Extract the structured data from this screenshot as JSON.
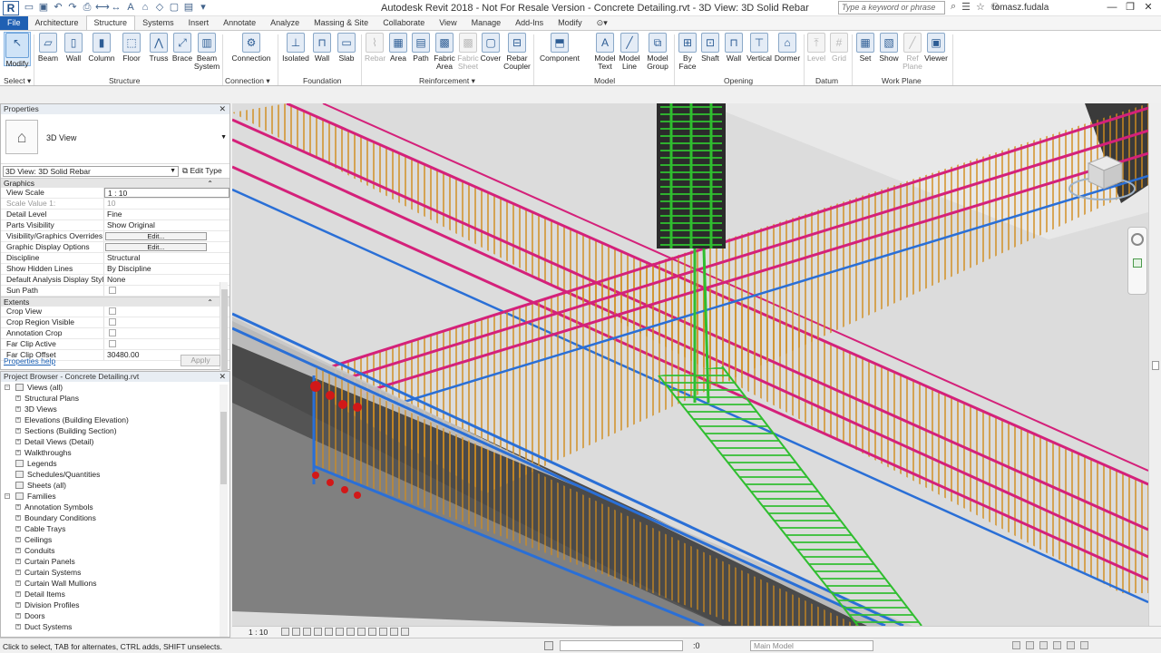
{
  "title_bar": {
    "app_title": "Autodesk Revit 2018 - Not For Resale Version -    Concrete Detailing.rvt - 3D View: 3D Solid Rebar",
    "search_placeholder": "Type a keyword or phrase",
    "user": "tomasz.fudala",
    "logo": "R"
  },
  "tabs": [
    "File",
    "Architecture",
    "Structure",
    "Systems",
    "Insert",
    "Annotate",
    "Analyze",
    "Massing & Site",
    "Collaborate",
    "View",
    "Manage",
    "Add-Ins",
    "Modify"
  ],
  "active_tab": "Structure",
  "ribbon": {
    "modify": "Modify",
    "select": "Select",
    "structure": {
      "label": "Structure",
      "buttons": [
        "Beam",
        "Wall",
        "Column",
        "Floor",
        "Truss",
        "Brace",
        "Beam System"
      ]
    },
    "connection": {
      "label": "Connection",
      "buttons": [
        "Connection"
      ]
    },
    "foundation": {
      "label": "Foundation",
      "buttons": [
        "Isolated",
        "Wall",
        "Slab"
      ]
    },
    "reinforcement": {
      "label": "Reinforcement",
      "buttons": [
        "Rebar",
        "Area",
        "Path",
        "Fabric Area",
        "Fabric Sheet",
        "Cover",
        "Rebar Coupler"
      ]
    },
    "model": {
      "label": "Model",
      "buttons": [
        "Component",
        "Model Text",
        "Model Line",
        "Model Group"
      ]
    },
    "opening": {
      "label": "Opening",
      "buttons": [
        "By Face",
        "Shaft",
        "Wall",
        "Vertical",
        "Dormer"
      ]
    },
    "datum": {
      "label": "Datum",
      "buttons": [
        "Level",
        "Grid"
      ]
    },
    "workplane": {
      "label": "Work Plane",
      "buttons": [
        "Set",
        "Show",
        "Ref Plane",
        "Viewer"
      ]
    }
  },
  "properties": {
    "header": "Properties",
    "type_name": "3D View",
    "instance_selector": "3D View: 3D Solid Rebar",
    "edit_type": "Edit Type",
    "sections": {
      "graphics": "Graphics",
      "extents": "Extents"
    },
    "graphics_rows": [
      {
        "k": "View Scale",
        "v": "1 : 10"
      },
      {
        "k": "Scale Value  1:",
        "v": "10"
      },
      {
        "k": "Detail Level",
        "v": "Fine"
      },
      {
        "k": "Parts Visibility",
        "v": "Show Original"
      },
      {
        "k": "Visibility/Graphics Overrides",
        "v": "Edit..."
      },
      {
        "k": "Graphic Display Options",
        "v": "Edit..."
      },
      {
        "k": "Discipline",
        "v": "Structural"
      },
      {
        "k": "Show Hidden Lines",
        "v": "By Discipline"
      },
      {
        "k": "Default Analysis Display Style",
        "v": "None"
      },
      {
        "k": "Sun Path",
        "v": ""
      }
    ],
    "extents_rows": [
      {
        "k": "Crop View",
        "v": ""
      },
      {
        "k": "Crop Region Visible",
        "v": ""
      },
      {
        "k": "Annotation Crop",
        "v": ""
      },
      {
        "k": "Far Clip Active",
        "v": ""
      },
      {
        "k": "Far Clip Offset",
        "v": "30480.00"
      }
    ],
    "help": "Properties help",
    "apply": "Apply"
  },
  "browser": {
    "header": "Project Browser - Concrete Detailing.rvt",
    "views_all": "Views (all)",
    "views": [
      "Structural Plans",
      "3D Views",
      "Elevations (Building Elevation)",
      "Sections (Building Section)",
      "Detail Views (Detail)",
      "Walkthroughs"
    ],
    "legends": "Legends",
    "schedules": "Schedules/Quantities",
    "sheets": "Sheets (all)",
    "families": "Families",
    "family_items": [
      "Annotation Symbols",
      "Boundary Conditions",
      "Cable Trays",
      "Ceilings",
      "Conduits",
      "Curtain Panels",
      "Curtain Systems",
      "Curtain Wall Mullions",
      "Detail Items",
      "Division Profiles",
      "Doors",
      "Duct Systems"
    ]
  },
  "view_bar": {
    "scale": "1 : 10"
  },
  "status": {
    "message": "Click to select, TAB for alternates, CTRL adds, SHIFT unselects.",
    "zero": ":0",
    "model": "Main Model"
  },
  "colors": {
    "accent": "#1f60b3",
    "rebar_magenta": "#d4217a",
    "rebar_blue": "#2a6fd6",
    "rebar_green": "#2bb52b",
    "rebar_orange": "#c98a1e"
  }
}
